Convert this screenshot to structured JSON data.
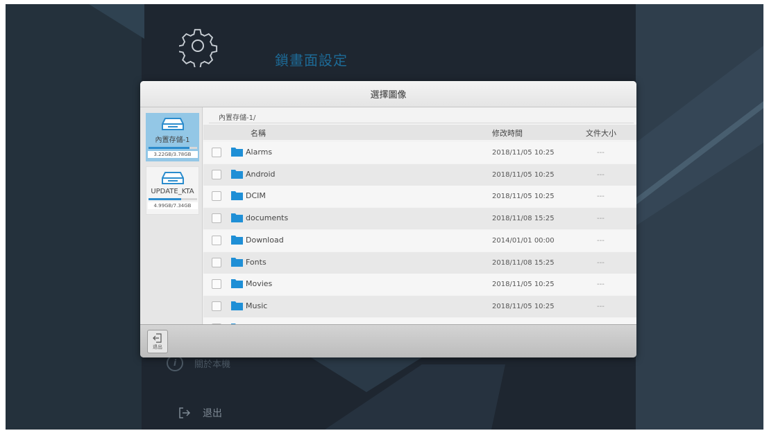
{
  "background": {
    "settings_title": "鎖畫面設定",
    "about_label": "關於本機",
    "exit_label": "退出",
    "icons": [
      "gear-icon",
      "info-icon",
      "exit-icon"
    ]
  },
  "dialog": {
    "title": "選擇圖像",
    "storages": [
      {
        "name": "內置存儲-1",
        "size": "3.22GB/3.78GB",
        "used_fraction": 0.85,
        "selected": true
      },
      {
        "name": "UPDATE_KTA",
        "size": "4.99GB/7.34GB",
        "used_fraction": 0.68,
        "selected": false
      }
    ],
    "breadcrumb": "內置存儲-1/",
    "columns": {
      "name": "名稱",
      "time": "修改時間",
      "size": "文件大小"
    },
    "files": [
      {
        "name": "Alarms",
        "time": "2018/11/05 10:25",
        "size": "---"
      },
      {
        "name": "Android",
        "time": "2018/11/05 10:25",
        "size": "---"
      },
      {
        "name": "DCIM",
        "time": "2018/11/05 10:25",
        "size": "---"
      },
      {
        "name": "documents",
        "time": "2018/11/08 15:25",
        "size": "---"
      },
      {
        "name": "Download",
        "time": "2014/01/01 00:00",
        "size": "---"
      },
      {
        "name": "Fonts",
        "time": "2018/11/08 15:25",
        "size": "---"
      },
      {
        "name": "Movies",
        "time": "2018/11/05 10:25",
        "size": "---"
      },
      {
        "name": "Music",
        "time": "2018/11/05 10:25",
        "size": "---"
      }
    ],
    "footer_exit_label": "退出",
    "colors": {
      "accent": "#2b8ccd",
      "selected_storage": "#93c7e6",
      "folder": "#1f8fd6"
    }
  }
}
